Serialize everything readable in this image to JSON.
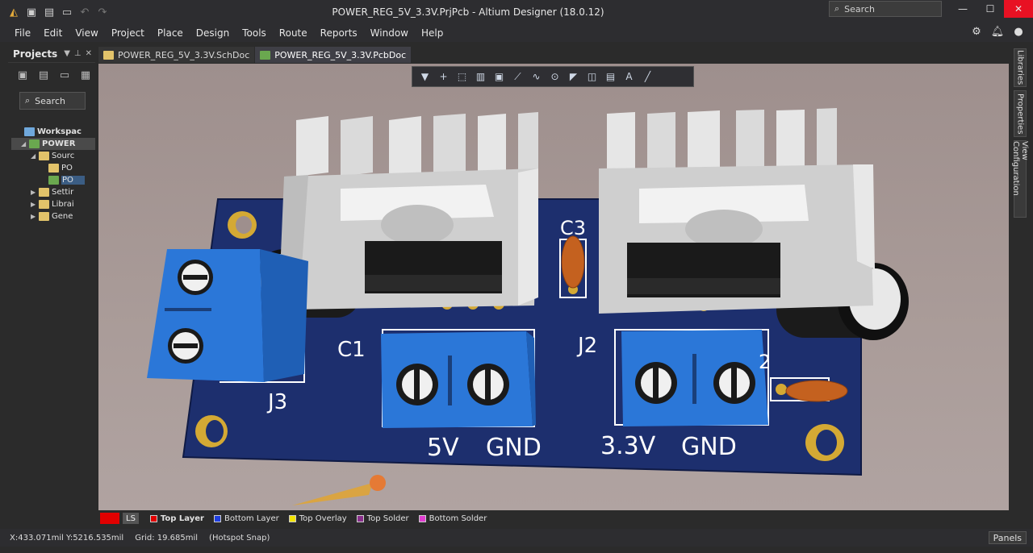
{
  "window": {
    "title": "POWER_REG_5V_3.3V.PrjPcb - Altium Designer (18.0.12)",
    "search_label": "Search",
    "minimize": "—",
    "maximize": "☐",
    "close": "✕"
  },
  "menu": {
    "items": [
      "File",
      "Edit",
      "View",
      "Project",
      "Place",
      "Design",
      "Tools",
      "Route",
      "Reports",
      "Window",
      "Help"
    ]
  },
  "projects": {
    "title": "Projects",
    "search_label": "Search",
    "tree": [
      {
        "label": "Workspac",
        "indent": 0,
        "arrow": "",
        "color": "#6fa8dc"
      },
      {
        "label": "POWER",
        "indent": 0,
        "arrow": "◢",
        "color": "#6aa84f"
      },
      {
        "label": "Sourc",
        "indent": 1,
        "arrow": "◢",
        "color": "#e2c36a"
      },
      {
        "label": "PO",
        "indent": 2,
        "arrow": "",
        "color": "#e2c36a"
      },
      {
        "label": "PO",
        "indent": 2,
        "arrow": "",
        "color": "#6aa84f"
      },
      {
        "label": "Settir",
        "indent": 1,
        "arrow": "▶",
        "color": "#e2c36a"
      },
      {
        "label": "Librai",
        "indent": 1,
        "arrow": "▶",
        "color": "#e2c36a"
      },
      {
        "label": "Gene",
        "indent": 1,
        "arrow": "▶",
        "color": "#e2c36a"
      }
    ]
  },
  "tabs": [
    {
      "label": "POWER_REG_5V_3.3V.SchDoc",
      "color": "#e2c36a"
    },
    {
      "label": "POWER_REG_5V_3.3V.PcbDoc",
      "color": "#6aa84f"
    }
  ],
  "side_tabs": [
    "Libraries",
    "Properties",
    "View Configuration"
  ],
  "pcb": {
    "labels": {
      "c3": "C3",
      "c1": "C1",
      "j2": "J2",
      "j3": "J3",
      "c2_partial": "2",
      "out_5v": "5V",
      "gnd1": "GND",
      "out_33v": "3.3V",
      "gnd2": "GND"
    },
    "colors": {
      "board": "#1d2f6e",
      "terminal": "#2b77d8",
      "heatsink": "#d6d6d6",
      "silkscreen": "#ffffff",
      "pad": "#d4a934"
    }
  },
  "layers": {
    "ls_label": "LS",
    "items": [
      {
        "label": "Top Layer",
        "color": "#e10000",
        "active": true
      },
      {
        "label": "Bottom Layer",
        "color": "#1f3fe0",
        "active": false
      },
      {
        "label": "Top Overlay",
        "color": "#f2e400",
        "active": false
      },
      {
        "label": "Top Solder",
        "color": "#8a2f8c",
        "active": false
      },
      {
        "label": "Bottom Solder",
        "color": "#e03ed0",
        "active": false
      }
    ]
  },
  "status": {
    "coords": "X:433.071mil Y:5216.535mil",
    "grid": "Grid: 19.685mil",
    "snap": "(Hotspot Snap)",
    "panels": "Panels"
  }
}
